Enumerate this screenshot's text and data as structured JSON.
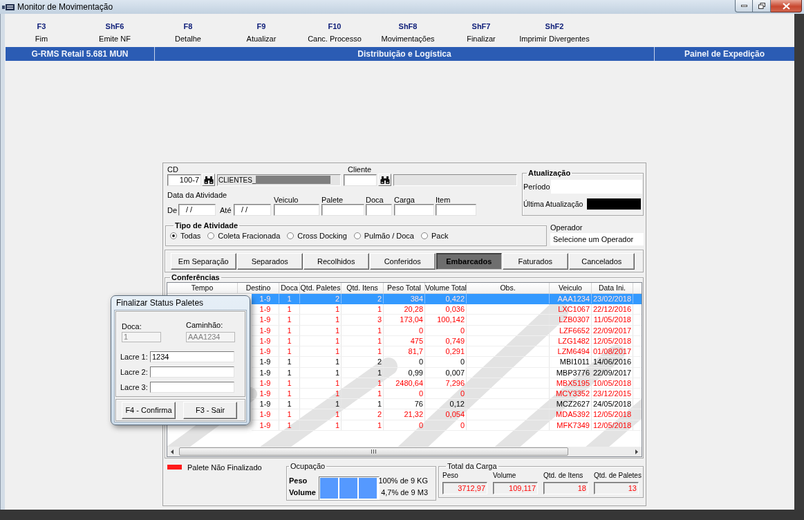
{
  "window": {
    "title": "Monitor de Movimentação"
  },
  "function_keys": [
    {
      "key": "F3",
      "label": "Fim"
    },
    {
      "key": "ShF6",
      "label": "Emite NF"
    },
    {
      "key": "F8",
      "label": "Detalhe"
    },
    {
      "key": "F9",
      "label": "Atualizar"
    },
    {
      "key": "F10",
      "label": "Canc. Processo"
    },
    {
      "key": "ShF8",
      "label": "Movimentações"
    },
    {
      "key": "ShF7",
      "label": "Finalizar"
    },
    {
      "key": "ShF2",
      "label": "Imprimir Divergentes"
    }
  ],
  "header_bar": {
    "system": "G-RMS Retail 5.681 MUN",
    "module": "Distribuição e Logística",
    "screen": "Painel de Expedição"
  },
  "filters": {
    "cd": {
      "label": "CD",
      "value": "100-7",
      "description": "CLIENTES_",
      "description_masked": true
    },
    "cliente": {
      "label": "Cliente"
    },
    "data_atividade": {
      "label": "Data da Atividade",
      "from_label": "De",
      "from_value": "/ /",
      "to_label": "Até",
      "to_value": "/ /"
    },
    "fields": [
      {
        "label": "Veiculo"
      },
      {
        "label": "Palete"
      },
      {
        "label": "Doca"
      },
      {
        "label": "Carga"
      },
      {
        "label": "Item"
      }
    ]
  },
  "atualizacao": {
    "title": "Atualização",
    "periodo_label": "Período",
    "ultima_label": "Última Atualização",
    "ultima_masked": true
  },
  "tipo_atividade": {
    "title": "Tipo de Atividade",
    "options": [
      {
        "label": "Todas",
        "selected": true
      },
      {
        "label": "Coleta Fracionada",
        "selected": false
      },
      {
        "label": "Cross Docking",
        "selected": false
      },
      {
        "label": "Pulmão / Doca",
        "selected": false
      },
      {
        "label": "Pack",
        "selected": false
      }
    ]
  },
  "operador": {
    "label": "Operador",
    "value": "Selecione um Operador"
  },
  "tabs": [
    {
      "label": "Em Separação",
      "selected": false
    },
    {
      "label": "Separados",
      "selected": false
    },
    {
      "label": "Recolhidos",
      "selected": false
    },
    {
      "label": "Conferidos",
      "selected": false
    },
    {
      "label": "Embarcados",
      "selected": true
    },
    {
      "label": "Faturados",
      "selected": false
    },
    {
      "label": "Cancelados",
      "selected": false
    }
  ],
  "conferencias": {
    "title": "Conferências",
    "columns": [
      "Tempo",
      "Destino",
      "Doca",
      "Qtd. Paletes",
      "Qtd. Itens",
      "Peso Total",
      "Volume Total",
      "Obs.",
      "Veiculo",
      "Data Ini."
    ],
    "rows": [
      {
        "destino": "1-9",
        "doca": "1",
        "qtd_paletes": "2",
        "qtd_itens": "2",
        "peso_total": "384",
        "volume_total": "0,422",
        "veiculo": "AAA1234",
        "data_ini": "23/02/2018",
        "selected": true,
        "finalized": false
      },
      {
        "destino": "1-9",
        "doca": "1",
        "qtd_paletes": "1",
        "qtd_itens": "1",
        "peso_total": "20,28",
        "volume_total": "0,036",
        "veiculo": "LXC1067",
        "data_ini": "22/12/2016",
        "selected": false,
        "finalized": false
      },
      {
        "destino": "1-9",
        "doca": "1",
        "qtd_paletes": "1",
        "qtd_itens": "3",
        "peso_total": "173,04",
        "volume_total": "100,142",
        "veiculo": "LZB0307",
        "data_ini": "11/05/2018",
        "selected": false,
        "finalized": false
      },
      {
        "destino": "1-9",
        "doca": "1",
        "qtd_paletes": "1",
        "qtd_itens": "1",
        "peso_total": "0",
        "volume_total": "0",
        "veiculo": "LZF6652",
        "data_ini": "22/09/2017",
        "selected": false,
        "finalized": false
      },
      {
        "destino": "1-9",
        "doca": "1",
        "qtd_paletes": "1",
        "qtd_itens": "1",
        "peso_total": "475",
        "volume_total": "0,749",
        "veiculo": "LZG1482",
        "data_ini": "12/05/2018",
        "selected": false,
        "finalized": false
      },
      {
        "destino": "1-9",
        "doca": "1",
        "qtd_paletes": "1",
        "qtd_itens": "1",
        "peso_total": "81,7",
        "volume_total": "0,291",
        "veiculo": "LZM6494",
        "data_ini": "01/08/2017",
        "selected": false,
        "finalized": false
      },
      {
        "destino": "1-9",
        "doca": "1",
        "qtd_paletes": "1",
        "qtd_itens": "2",
        "peso_total": "0",
        "volume_total": "0",
        "veiculo": "MBI1011",
        "data_ini": "14/06/2016",
        "selected": false,
        "finalized": true
      },
      {
        "destino": "1-9",
        "doca": "1",
        "qtd_paletes": "1",
        "qtd_itens": "1",
        "peso_total": "0,99",
        "volume_total": "0,007",
        "veiculo": "MBP3776",
        "data_ini": "22/09/2017",
        "selected": false,
        "finalized": true
      },
      {
        "destino": "1-9",
        "doca": "1",
        "qtd_paletes": "1",
        "qtd_itens": "1",
        "peso_total": "2480,64",
        "volume_total": "7,296",
        "veiculo": "MBX5195",
        "data_ini": "10/05/2018",
        "selected": false,
        "finalized": false
      },
      {
        "destino": "1-9",
        "doca": "1",
        "qtd_paletes": "1",
        "qtd_itens": "1",
        "peso_total": "0",
        "volume_total": "0",
        "veiculo": "MCY3352",
        "data_ini": "23/12/2015",
        "selected": false,
        "finalized": false
      },
      {
        "destino": "1-9",
        "doca": "1",
        "qtd_paletes": "1",
        "qtd_itens": "1",
        "peso_total": "76",
        "volume_total": "0,12",
        "veiculo": "MCZ2627",
        "data_ini": "24/05/2018",
        "selected": false,
        "finalized": true
      },
      {
        "destino": "1-9",
        "doca": "1",
        "qtd_paletes": "1",
        "qtd_itens": "2",
        "peso_total": "21,32",
        "volume_total": "0,054",
        "veiculo": "MDA5392",
        "data_ini": "12/05/2018",
        "selected": false,
        "finalized": false
      },
      {
        "destino": "1-9",
        "doca": "1",
        "qtd_paletes": "1",
        "qtd_itens": "1",
        "peso_total": "0",
        "volume_total": "0",
        "veiculo": "MFK7349",
        "data_ini": "12/05/2018",
        "selected": false,
        "finalized": false
      }
    ]
  },
  "legend": {
    "label": "Palete Não Finalizado"
  },
  "ocupacao": {
    "title": "Ocupação",
    "level": 1,
    "rows": [
      {
        "label": "Peso",
        "reading": "100% de 9 KG"
      },
      {
        "label": "Volume",
        "reading": "4,7% de 9 M3"
      }
    ]
  },
  "total_carga": {
    "title": "Total da Carga",
    "fields": [
      {
        "label": "Peso",
        "value": "3712,97"
      },
      {
        "label": "Volume",
        "value": "109,117"
      },
      {
        "label": "Qtd. de Itens",
        "value": "18"
      },
      {
        "label": "Qtd. de Paletes",
        "value": "13"
      }
    ]
  },
  "dialog": {
    "title": "Finalizar Status Paletes",
    "doca": {
      "label": "Doca:",
      "value": "1",
      "disabled": true
    },
    "caminhao": {
      "label": "Caminhão:",
      "value": "AAA1234",
      "disabled": true
    },
    "lacres": [
      {
        "label": "Lacre 1:",
        "value": "1234"
      },
      {
        "label": "Lacre 2:"
      },
      {
        "label": "Lacre 3:"
      }
    ],
    "buttons": [
      "F4 - Confirma",
      "F3 - Sair"
    ]
  }
}
